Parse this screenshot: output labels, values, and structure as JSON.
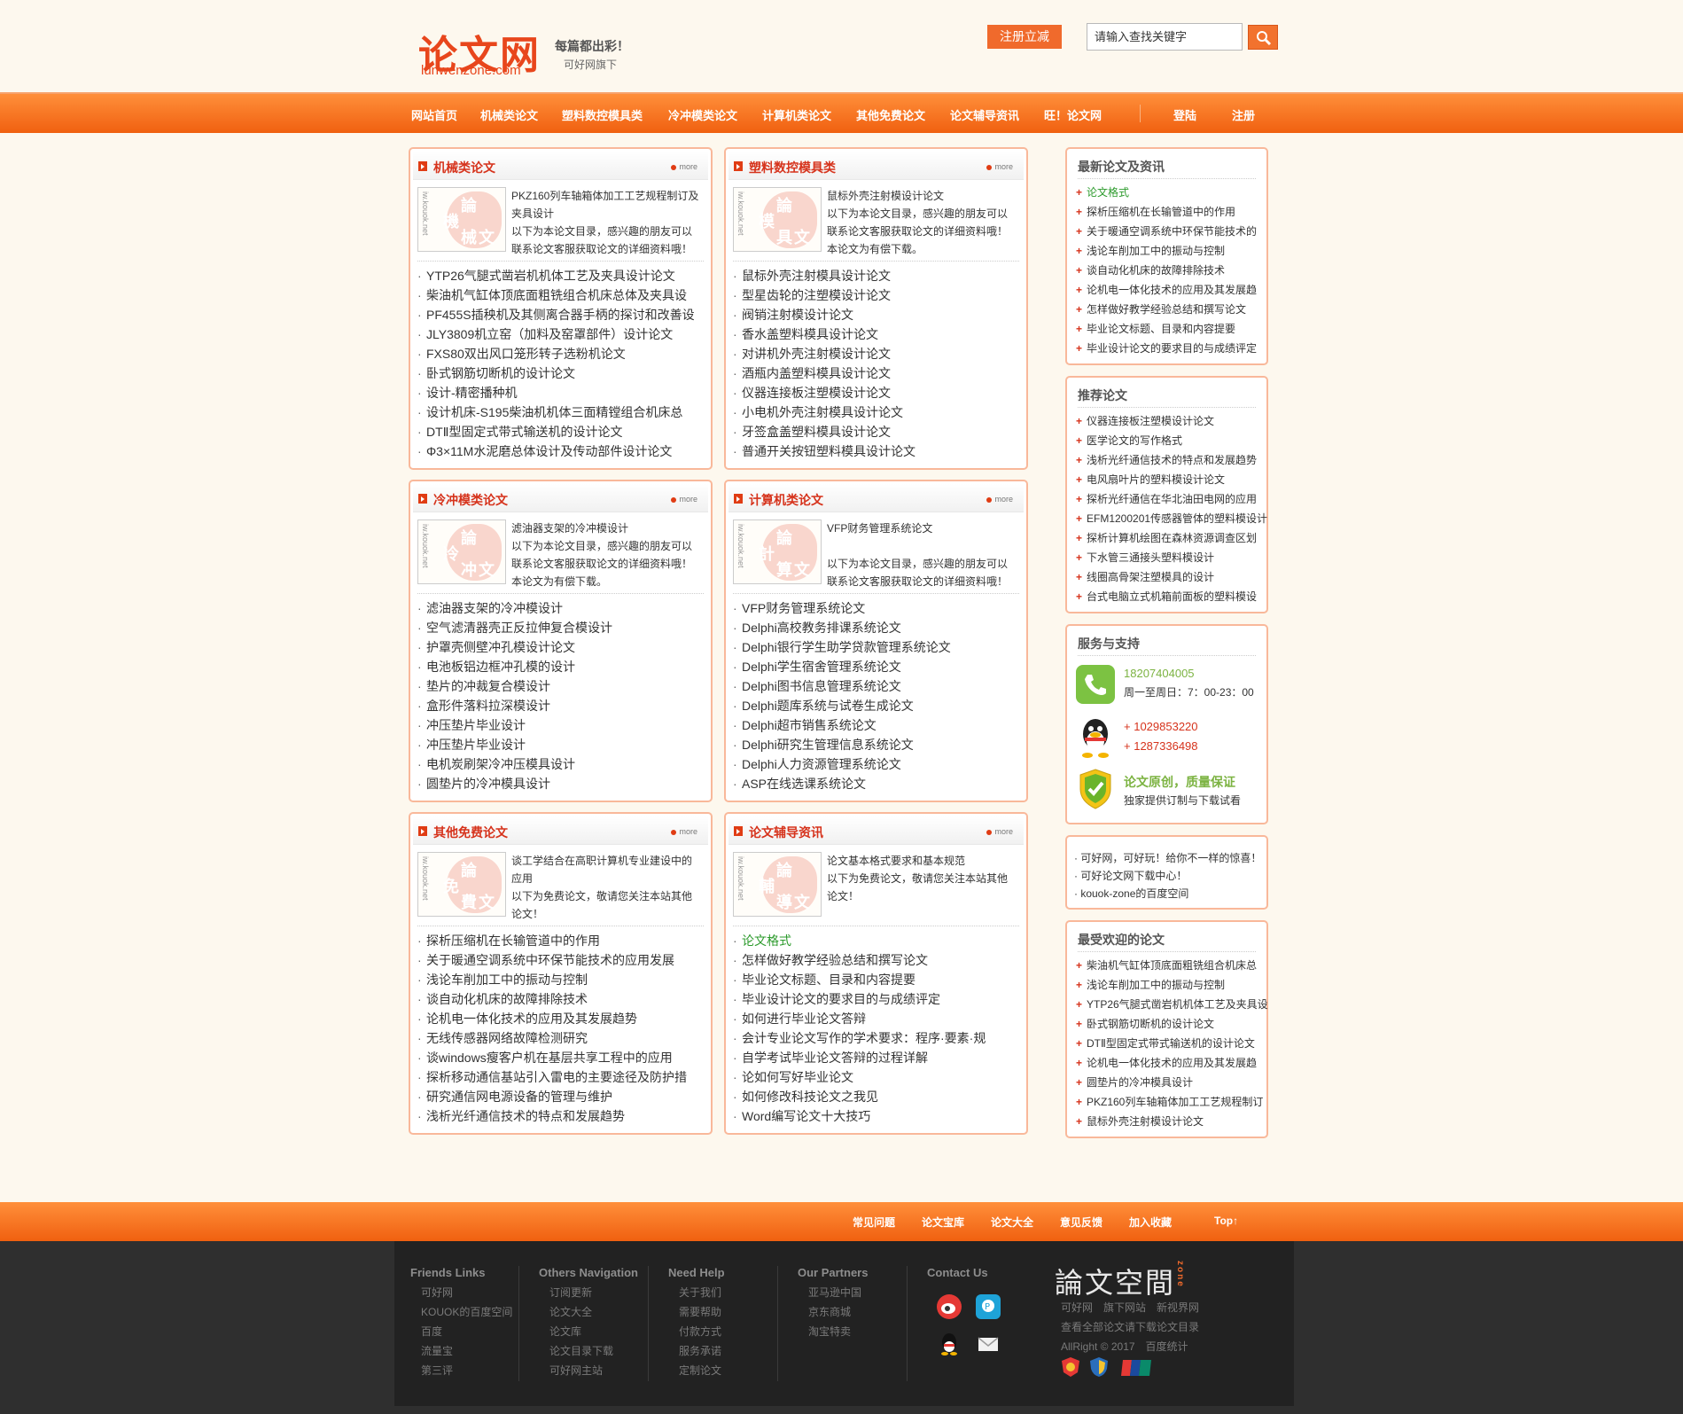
{
  "header": {
    "logo_text": "论文网",
    "logo_domain": "lunwenzone.com",
    "slogan": "每篇都出彩！",
    "byline": "可好网旗下",
    "register_promo": "注册立减",
    "search_placeholder": "请输入查找关键字"
  },
  "nav": {
    "items": [
      "网站首页",
      "机械类论文",
      "塑料数控模具类",
      "冷冲模类论文",
      "计算机类论文",
      "其他免费论文",
      "论文辅导资讯",
      "旺！论文网"
    ],
    "login": "登陆",
    "register": "注册"
  },
  "panels": [
    {
      "title": "机械类论文",
      "more": "more",
      "thumb_chars": [
        "論",
        "機",
        "械",
        "文"
      ],
      "desc": [
        "PKZ160列车轴箱体加工工艺规程制订及夹具设计",
        "以下为本论文目录，感兴趣的朋友可以联系论文客服获取论文的详细资料哦！"
      ],
      "items": [
        "YTP26气腿式凿岩机机体工艺及夹具设计论文",
        "柴油机气缸体顶底面粗铣组合机床总体及夹具设",
        "PF455S插秧机及其侧离合器手柄的探讨和改善设",
        "JLY3809机立窑（加料及窑罩部件）设计论文",
        "FXS80双出风口笼形转子选粉机论文",
        "卧式钢筋切断机的设计论文",
        "设计-精密播种机",
        "设计机床-S195柴油机机体三面精镗组合机床总",
        "DTⅡ型固定式带式输送机的设计论文",
        "Φ3×11M水泥磨总体设计及传动部件设计论文"
      ]
    },
    {
      "title": "塑料数控模具类",
      "more": "more",
      "thumb_chars": [
        "論",
        "模",
        "具",
        "文"
      ],
      "desc": [
        "鼠标外壳注射模设计论文",
        "以下为本论文目录，感兴趣的朋友可以联系论文客服获取论文的详细资料哦！",
        "本论文为有偿下载。"
      ],
      "items": [
        "鼠标外壳注射模具设计论文",
        "型星齿轮的注塑模设计论文",
        "阀销注射模设计论文",
        "香水盖塑料模具设计论文",
        "对讲机外壳注射模设计论文",
        "酒瓶内盖塑料模具设计论文",
        "仪器连接板注塑模设计论文",
        "小电机外壳注射模具设计论文",
        "牙签盒盖塑料模具设计论文",
        "普通开关按钮塑料模具设计论文"
      ]
    },
    {
      "title": "冷冲模类论文",
      "more": "more",
      "thumb_chars": [
        "論",
        "冷",
        "冲",
        "文"
      ],
      "desc": [
        "滤油器支架的冷冲模设计",
        "以下为本论文目录，感兴趣的朋友可以联系论文客服获取论文的详细资料哦！",
        "本论文为有偿下载。"
      ],
      "items": [
        "滤油器支架的冷冲模设计",
        "空气滤清器壳正反拉伸复合模设计",
        "护罩壳侧壁冲孔模设计论文",
        "电池板铝边框冲孔模的设计",
        "垫片的冲裁复合模设计",
        "盒形件落料拉深模设计",
        "冲压垫片毕业设计",
        "冲压垫片毕业设计",
        "电机炭刷架冷冲压模具设计",
        "圆垫片的冷冲模具设计"
      ]
    },
    {
      "title": "计算机类论文",
      "more": "more",
      "thumb_chars": [
        "論",
        "計",
        "算",
        "文"
      ],
      "desc": [
        "VFP财务管理系统论文",
        "",
        "以下为本论文目录，感兴趣的朋友可以联系论文客服获取论文的详细资料哦！"
      ],
      "items": [
        "VFP财务管理系统论文",
        "Delphi高校教务排课系统论文",
        "Delphi银行学生助学贷款管理系统论文",
        "Delphi学生宿舍管理系统论文",
        "Delphi图书信息管理系统论文",
        "Delphi题库系统与试卷生成论文",
        "Delphi超市销售系统论文",
        "Delphi研究生管理信息系统论文",
        "Delphi人力资源管理系统论文",
        "ASP在线选课系统论文"
      ]
    },
    {
      "title": "其他免费论文",
      "more": "more",
      "thumb_chars": [
        "論",
        "免",
        "費",
        "文"
      ],
      "desc": [
        "谈工学结合在高职计算机专业建设中的应用",
        "以下为免费论文，敬请您关注本站其他论文！"
      ],
      "items": [
        "探析压缩机在长输管道中的作用",
        "关于暖通空调系统中环保节能技术的应用发展",
        "浅论车削加工中的振动与控制",
        "谈自动化机床的故障排除技术",
        "论机电一体化技术的应用及其发展趋势",
        "无线传感器网络故障检测研究",
        "谈windows瘦客户机在基层共享工程中的应用",
        "探析移动通信基站引入雷电的主要途径及防护措",
        "研究通信网电源设备的管理与维护",
        "浅析光纤通信技术的特点和发展趋势"
      ]
    },
    {
      "title": "论文辅导资讯",
      "more": "more",
      "thumb_chars": [
        "論",
        "輔",
        "導",
        "文"
      ],
      "desc": [
        "论文基本格式要求和基本规范",
        "以下为免费论文，敬请您关注本站其他论文！"
      ],
      "items": [
        "论文格式",
        "怎样做好教学经验总结和撰写论文",
        "毕业论文标题、目录和内容提要",
        "毕业设计论文的要求目的与成绩评定",
        "如何进行毕业论文答辩",
        "会计专业论文写作的学术要求：程序·要素·规",
        "自学考试毕业论文答辩的过程详解",
        "论如何写好毕业论文",
        "如何修改科技论文之我见",
        "Word编写论文十大技巧"
      ]
    }
  ],
  "sidebar": {
    "latest": {
      "title": "最新论文及资讯",
      "items": [
        "论文格式",
        "探析压缩机在长输管道中的作用",
        "关于暖通空调系统中环保节能技术的",
        "浅论车削加工中的振动与控制",
        "谈自动化机床的故障排除技术",
        "论机电一体化技术的应用及其发展趋",
        "怎样做好教学经验总结和撰写论文",
        "毕业论文标题、目录和内容提要",
        "毕业设计论文的要求目的与成绩评定"
      ]
    },
    "recommended": {
      "title": "推荐论文",
      "items": [
        "仪器连接板注塑模设计论文",
        "医学论文的写作格式",
        "浅析光纤通信技术的特点和发展趋势",
        "电风扇叶片的塑料模设计论文",
        "探析光纤通信在华北油田电网的应用",
        "EFM1200201传感器管体的塑料模设计",
        "探析计算机绘图在森林资源调查区划",
        "下水管三通接头塑料模设计",
        "线圈高骨架注塑模具的设计",
        "台式电脑立式机箱前面板的塑料模设"
      ]
    },
    "service": {
      "title": "服务与支持",
      "phone": "18207404005",
      "hours": "周一至周日：7：00-23：00",
      "qq1": "1029853220",
      "qq2": "1287336498",
      "guarantee": "论文原创，质量保证",
      "guarantee_sub": "独家提供订制与下载试看"
    },
    "notes": [
      "· 可好网，可好玩！给你不一样的惊喜！",
      "· 可好论文网下载中心！",
      "· kouok-zone的百度空间"
    ],
    "popular": {
      "title": "最受欢迎的论文",
      "items": [
        "柴油机气缸体顶底面粗铣组合机床总",
        "浅论车削加工中的振动与控制",
        "YTP26气腿式凿岩机机体工艺及夹具设",
        "卧式钢筋切断机的设计论文",
        "DTⅡ型固定式带式输送机的设计论文",
        "论机电一体化技术的应用及其发展趋",
        "圆垫片的冷冲模具设计",
        "PKZ160列车轴箱体加工工艺规程制订",
        "鼠标外壳注射模设计论文"
      ]
    }
  },
  "footer_bar": {
    "links": [
      "常见问题",
      "论文宝库",
      "论文大全",
      "意见反馈",
      "加入收藏",
      "Top↑"
    ]
  },
  "footer": {
    "columns": [
      {
        "title": "Friends Links",
        "items": [
          "可好网",
          "KOUOK的百度空间",
          "百度",
          "流量宝",
          "第三评"
        ]
      },
      {
        "title": "Others Navigation",
        "items": [
          "订阅更新",
          "论文大全",
          "论文库",
          "论文目录下载",
          "可好网主站"
        ]
      },
      {
        "title": "Need Help",
        "items": [
          "关于我们",
          "需要帮助",
          "付款方式",
          "服务承诺",
          "定制论文"
        ]
      },
      {
        "title": "Our Partners",
        "items": [
          "亚马逊中国",
          "京东商城",
          "淘宝特卖"
        ]
      },
      {
        "title": "Contact Us",
        "items": []
      }
    ],
    "brand": "論文空間",
    "brand_tag": "zone",
    "brand_links": "可好网　旗下网站　新视界网",
    "brand_line2": "查看全部论文请下载论文目录",
    "copyright": "AllRight © 2017　百度统计"
  },
  "colors": {
    "accent": "#f06a2c",
    "title_red": "#d6331c",
    "panel_border": "#f9b89a",
    "footer_bg": "#2f2f2f"
  }
}
